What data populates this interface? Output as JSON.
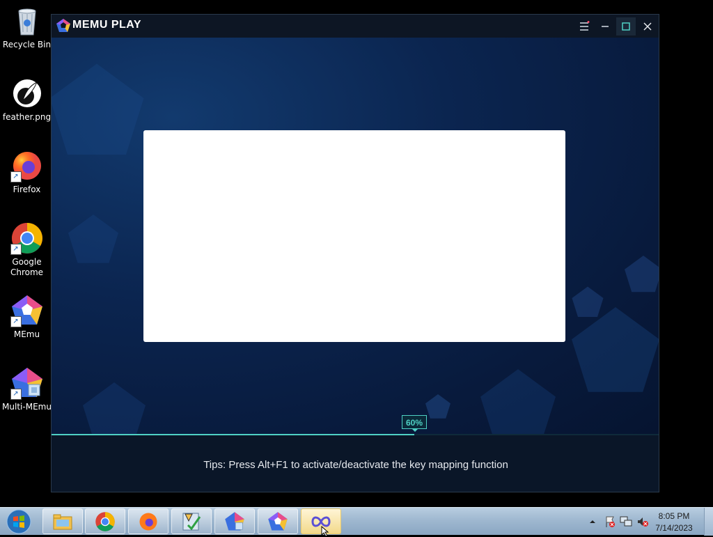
{
  "desktop": {
    "icons": [
      {
        "label": "Recycle Bin",
        "icon": "recycle-bin-icon"
      },
      {
        "label": "feather.png",
        "icon": "feather-image-icon"
      },
      {
        "label": "Firefox",
        "icon": "firefox-icon"
      },
      {
        "label": "Google\nChrome",
        "icon": "chrome-icon"
      },
      {
        "label": "MEmu",
        "icon": "memu-icon"
      },
      {
        "label": "Multi-MEmu",
        "icon": "multi-memu-icon"
      }
    ]
  },
  "window": {
    "brand": "MEMU PLAY",
    "progress_label": "60%",
    "progress": 0.6,
    "tips": "Tips: Press Alt+F1 to activate/deactivate the key mapping function",
    "colors": {
      "accent": "#4fd1c5",
      "titlebar": "#0d1624",
      "background": "#0b2550"
    }
  },
  "taskbar": {
    "apps": [
      {
        "icon": "file-explorer-icon"
      },
      {
        "icon": "chrome-icon"
      },
      {
        "icon": "firefox-icon"
      },
      {
        "icon": "checklist-app-icon"
      },
      {
        "icon": "multi-memu-icon"
      },
      {
        "icon": "memu-icon"
      },
      {
        "icon": "memu-loading-icon",
        "active": true
      }
    ],
    "clock": {
      "time": "8:05 PM",
      "date": "7/14/2023"
    }
  }
}
